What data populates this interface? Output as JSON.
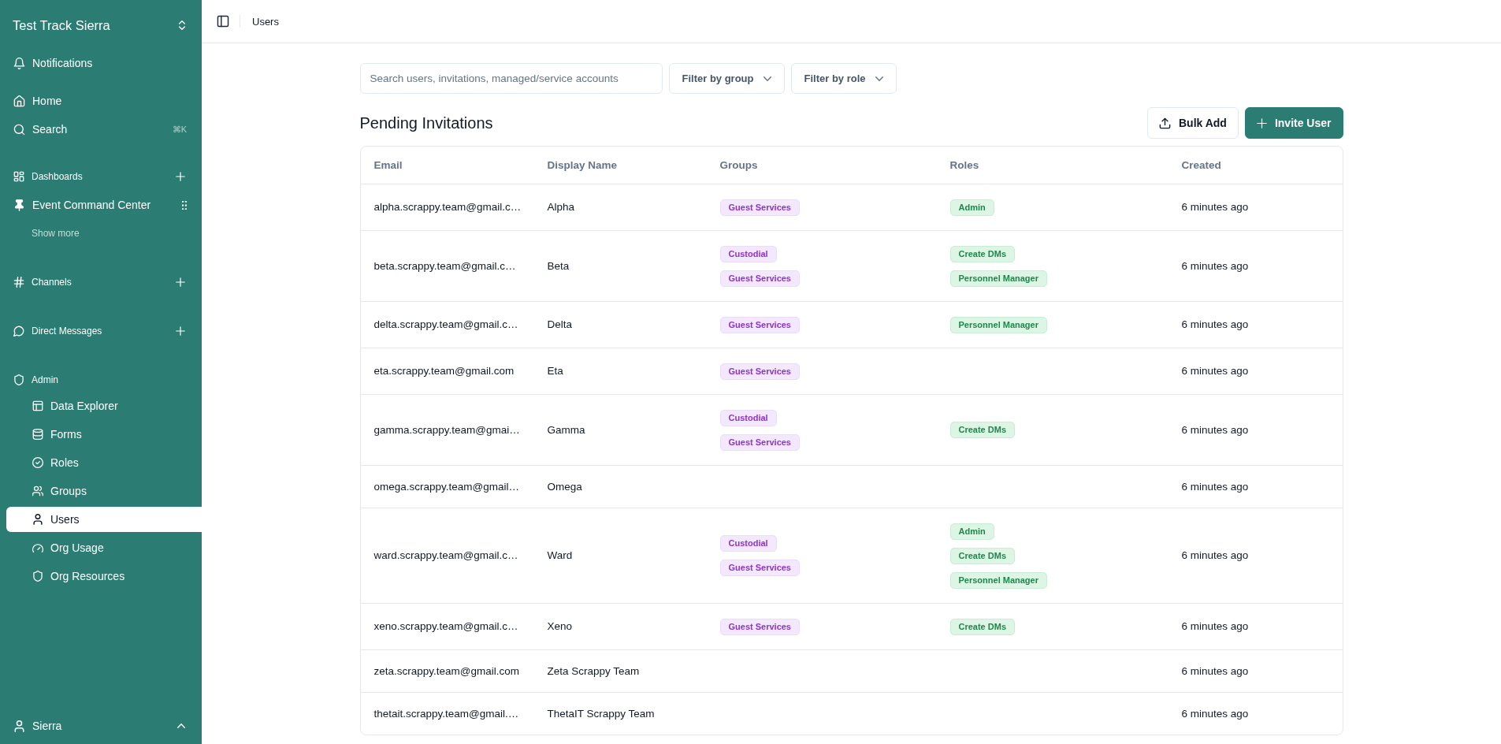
{
  "sidebar": {
    "workspace": "Test Track Sierra",
    "notifications": {
      "label": "Notifications",
      "selected": false
    },
    "nav": [
      {
        "label": "Home",
        "selected": false
      },
      {
        "label": "Search",
        "shortcut": "⌘K",
        "selected": false
      }
    ],
    "sections": [
      {
        "title": "Dashboards",
        "addable": true,
        "items": [
          {
            "label": "Event Command Center",
            "kind": "pinned",
            "selected": false
          }
        ],
        "show_more": "Show more"
      },
      {
        "title": "Channels",
        "addable": true
      },
      {
        "title": "Direct Messages",
        "addable": true
      },
      {
        "title": "Admin",
        "addable": false,
        "items": [
          {
            "label": "Data Explorer",
            "kind": "link",
            "selected": false
          },
          {
            "label": "Forms",
            "kind": "link",
            "selected": false
          },
          {
            "label": "Roles",
            "kind": "link",
            "selected": false
          },
          {
            "label": "Groups",
            "kind": "link",
            "selected": false
          },
          {
            "label": "Users",
            "kind": "link",
            "selected": true
          },
          {
            "label": "Org Usage",
            "kind": "link",
            "selected": false
          },
          {
            "label": "Org Resources",
            "kind": "link",
            "selected": false
          }
        ]
      }
    ],
    "user": {
      "name": "Sierra"
    }
  },
  "header": {
    "breadcrumb": "Users"
  },
  "toolbar": {
    "search": {
      "placeholder": "Search users, invitations, managed/service accounts"
    },
    "filters": [
      {
        "label": "Filter by group"
      },
      {
        "label": "Filter by role"
      }
    ]
  },
  "section": {
    "title": "Pending Invitations",
    "buttons": [
      {
        "label": "Bulk Add",
        "kind": "secondary"
      },
      {
        "label": "Invite User",
        "kind": "primary"
      }
    ]
  },
  "table": {
    "columns": [
      "Email",
      "Display Name",
      "Groups",
      "Roles",
      "Created"
    ],
    "rows": [
      {
        "email": "alpha.scrappy.team@gmail.c…",
        "display_name": "Alpha",
        "groups": [
          "Guest Services"
        ],
        "roles": [
          "Admin"
        ],
        "created": "6 minutes ago"
      },
      {
        "email": "beta.scrappy.team@gmail.c…",
        "display_name": "Beta",
        "groups": [
          "Custodial",
          "Guest Services"
        ],
        "roles": [
          "Create DMs",
          "Personnel Manager"
        ],
        "created": "6 minutes ago"
      },
      {
        "email": "delta.scrappy.team@gmail.c…",
        "display_name": "Delta",
        "groups": [
          "Guest Services"
        ],
        "roles": [
          "Personnel Manager"
        ],
        "created": "6 minutes ago"
      },
      {
        "email": "eta.scrappy.team@gmail.com",
        "display_name": "Eta",
        "groups": [
          "Guest Services"
        ],
        "created": "6 minutes ago"
      },
      {
        "email": "gamma.scrappy.team@gmai…",
        "display_name": "Gamma",
        "groups": [
          "Custodial",
          "Guest Services"
        ],
        "roles": [
          "Create DMs"
        ],
        "created": "6 minutes ago"
      },
      {
        "email": "omega.scrappy.team@gmail…",
        "display_name": "Omega",
        "created": "6 minutes ago"
      },
      {
        "email": "ward.scrappy.team@gmail.c…",
        "display_name": "Ward",
        "groups": [
          "Custodial",
          "Guest Services"
        ],
        "roles": [
          "Admin",
          "Create DMs",
          "Personnel Manager"
        ],
        "created": "6 minutes ago"
      },
      {
        "email": "xeno.scrappy.team@gmail.c…",
        "display_name": "Xeno",
        "groups": [
          "Guest Services"
        ],
        "roles": [
          "Create DMs"
        ],
        "created": "6 minutes ago"
      },
      {
        "email": "zeta.scrappy.team@gmail.com",
        "display_name": "Zeta Scrappy Team",
        "created": "6 minutes ago"
      },
      {
        "email": "thetait.scrappy.team@gmail.…",
        "display_name": "ThetaIT Scrappy Team",
        "created": "6 minutes ago"
      }
    ]
  }
}
